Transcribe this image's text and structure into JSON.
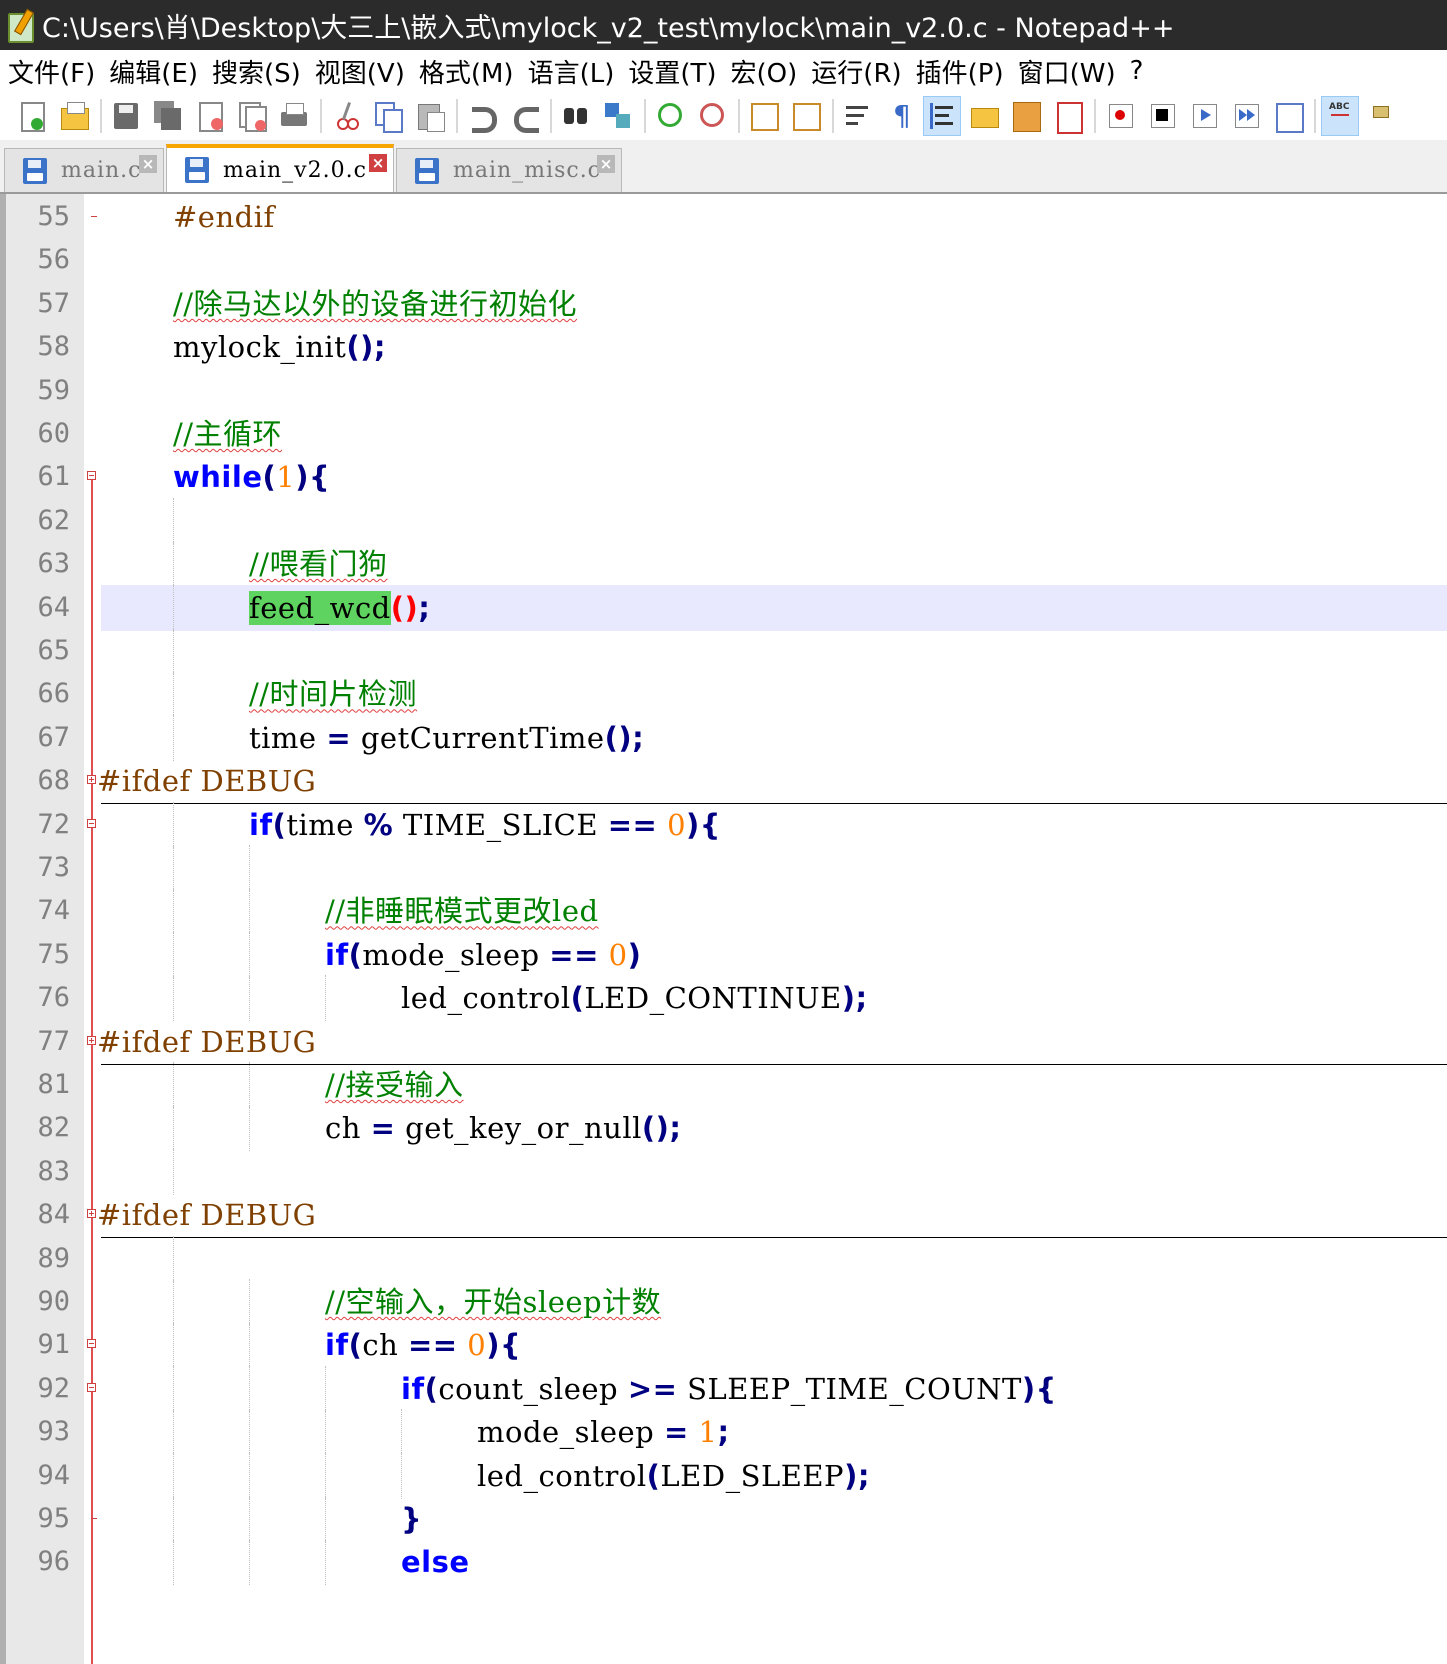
{
  "window": {
    "title": "C:\\Users\\肖\\Desktop\\大三上\\嵌入式\\mylock_v2_test\\mylock\\main_v2.0.c - Notepad++"
  },
  "menu": [
    "文件(F)",
    "编辑(E)",
    "搜索(S)",
    "视图(V)",
    "格式(M)",
    "语言(L)",
    "设置(T)",
    "宏(O)",
    "运行(R)",
    "插件(P)",
    "窗口(W)",
    "?"
  ],
  "toolbar": {
    "icons": [
      "new-file-icon",
      "open-file-icon",
      "save-icon",
      "save-all-icon",
      "close-icon",
      "close-all-icon",
      "print-icon",
      "cut-icon",
      "copy-icon",
      "paste-icon",
      "undo-icon",
      "redo-icon",
      "find-icon",
      "replace-icon",
      "zoom-in-icon",
      "zoom-out-icon",
      "sync-vertical-icon",
      "sync-horizontal-icon",
      "word-wrap-icon",
      "show-all-chars-icon",
      "indent-guide-icon",
      "user-define-lang-icon",
      "doc-map-icon",
      "function-list-icon",
      "record-macro-icon",
      "stop-record-icon",
      "play-macro-icon",
      "run-macro-multiple-icon",
      "save-macro-icon",
      "spell-check-icon",
      "spell-options-icon"
    ]
  },
  "tabs": [
    {
      "label": "main.c",
      "active": false
    },
    {
      "label": "main_v2.0.c",
      "active": true
    },
    {
      "label": "main_misc.c",
      "active": false
    }
  ],
  "editor": {
    "current_line": "64",
    "lines": [
      {
        "num": "55",
        "indent": "    ",
        "tokens": [
          {
            "t": "#endif",
            "c": "pp"
          }
        ]
      },
      {
        "num": "56",
        "indent": "",
        "tokens": []
      },
      {
        "num": "57",
        "indent": "    ",
        "tokens": [
          {
            "t": "//除马达以外的设备进行初始化",
            "c": "cm"
          }
        ]
      },
      {
        "num": "58",
        "indent": "    ",
        "tokens": [
          {
            "t": "mylock_init",
            "c": ""
          },
          {
            "t": "();",
            "c": "op"
          }
        ]
      },
      {
        "num": "59",
        "indent": "",
        "tokens": []
      },
      {
        "num": "60",
        "indent": "    ",
        "tokens": [
          {
            "t": "//主循环",
            "c": "cm"
          }
        ]
      },
      {
        "num": "61",
        "indent": "    ",
        "tokens": [
          {
            "t": "while",
            "c": "kw"
          },
          {
            "t": "(",
            "c": "op"
          },
          {
            "t": "1",
            "c": "num"
          },
          {
            "t": "){",
            "c": "op"
          }
        ]
      },
      {
        "num": "62",
        "indent": "",
        "tokens": []
      },
      {
        "num": "63",
        "indent": "        ",
        "tokens": [
          {
            "t": "//喂看门狗",
            "c": "cm"
          }
        ]
      },
      {
        "num": "64",
        "indent": "        ",
        "tokens": [
          {
            "t": "feed_wcd",
            "c": "hl"
          },
          {
            "t": "()",
            "c": "br-red"
          },
          {
            "t": ";",
            "c": "op"
          }
        ]
      },
      {
        "num": "65",
        "indent": "",
        "tokens": []
      },
      {
        "num": "66",
        "indent": "        ",
        "tokens": [
          {
            "t": "//时间片检测",
            "c": "cm"
          }
        ]
      },
      {
        "num": "67",
        "indent": "        ",
        "tokens": [
          {
            "t": "time ",
            "c": ""
          },
          {
            "t": "=",
            "c": "op"
          },
          {
            "t": " getCurrentTime",
            "c": ""
          },
          {
            "t": "();",
            "c": "op"
          }
        ]
      },
      {
        "num": "68",
        "indent": "",
        "tokens": [
          {
            "t": "#ifdef DEBUG",
            "c": "pp"
          }
        ]
      },
      {
        "num": "72",
        "indent": "        ",
        "tokens": [
          {
            "t": "if",
            "c": "kw"
          },
          {
            "t": "(",
            "c": "op"
          },
          {
            "t": "time ",
            "c": ""
          },
          {
            "t": "%",
            "c": "op"
          },
          {
            "t": " TIME_SLICE ",
            "c": ""
          },
          {
            "t": "==",
            "c": "op"
          },
          {
            "t": " ",
            "c": ""
          },
          {
            "t": "0",
            "c": "num"
          },
          {
            "t": "){",
            "c": "op"
          }
        ]
      },
      {
        "num": "73",
        "indent": "",
        "tokens": []
      },
      {
        "num": "74",
        "indent": "            ",
        "tokens": [
          {
            "t": "//非睡眠模式更改led",
            "c": "cm"
          }
        ]
      },
      {
        "num": "75",
        "indent": "            ",
        "tokens": [
          {
            "t": "if",
            "c": "kw"
          },
          {
            "t": "(",
            "c": "op"
          },
          {
            "t": "mode_sleep ",
            "c": ""
          },
          {
            "t": "==",
            "c": "op"
          },
          {
            "t": " ",
            "c": ""
          },
          {
            "t": "0",
            "c": "num"
          },
          {
            "t": ")",
            "c": "op"
          }
        ]
      },
      {
        "num": "76",
        "indent": "                ",
        "tokens": [
          {
            "t": "led_control",
            "c": ""
          },
          {
            "t": "(",
            "c": "op"
          },
          {
            "t": "LED_CONTINUE",
            "c": ""
          },
          {
            "t": ");",
            "c": "op"
          }
        ]
      },
      {
        "num": "77",
        "indent": "",
        "tokens": [
          {
            "t": "#ifdef DEBUG",
            "c": "pp"
          }
        ]
      },
      {
        "num": "81",
        "indent": "            ",
        "tokens": [
          {
            "t": "//接受输入",
            "c": "cm"
          }
        ]
      },
      {
        "num": "82",
        "indent": "            ",
        "tokens": [
          {
            "t": "ch ",
            "c": ""
          },
          {
            "t": "=",
            "c": "op"
          },
          {
            "t": " get_key_or_null",
            "c": ""
          },
          {
            "t": "();",
            "c": "op"
          }
        ]
      },
      {
        "num": "83",
        "indent": "",
        "tokens": []
      },
      {
        "num": "84",
        "indent": "",
        "tokens": [
          {
            "t": "#ifdef DEBUG",
            "c": "pp"
          }
        ]
      },
      {
        "num": "89",
        "indent": "",
        "tokens": []
      },
      {
        "num": "90",
        "indent": "            ",
        "tokens": [
          {
            "t": "//空输入，开始sleep计数",
            "c": "cm"
          }
        ]
      },
      {
        "num": "91",
        "indent": "            ",
        "tokens": [
          {
            "t": "if",
            "c": "kw"
          },
          {
            "t": "(",
            "c": "op"
          },
          {
            "t": "ch ",
            "c": ""
          },
          {
            "t": "==",
            "c": "op"
          },
          {
            "t": " ",
            "c": ""
          },
          {
            "t": "0",
            "c": "num"
          },
          {
            "t": "){",
            "c": "op"
          }
        ]
      },
      {
        "num": "92",
        "indent": "                ",
        "tokens": [
          {
            "t": "if",
            "c": "kw"
          },
          {
            "t": "(",
            "c": "op"
          },
          {
            "t": "count_sleep ",
            "c": ""
          },
          {
            "t": ">=",
            "c": "op"
          },
          {
            "t": " SLEEP_TIME_COUNT",
            "c": ""
          },
          {
            "t": "){",
            "c": "op"
          }
        ]
      },
      {
        "num": "93",
        "indent": "                    ",
        "tokens": [
          {
            "t": "mode_sleep ",
            "c": ""
          },
          {
            "t": "=",
            "c": "op"
          },
          {
            "t": " ",
            "c": ""
          },
          {
            "t": "1",
            "c": "num"
          },
          {
            "t": ";",
            "c": "op"
          }
        ]
      },
      {
        "num": "94",
        "indent": "                    ",
        "tokens": [
          {
            "t": "led_control",
            "c": ""
          },
          {
            "t": "(",
            "c": "op"
          },
          {
            "t": "LED_SLEEP",
            "c": ""
          },
          {
            "t": ");",
            "c": "op"
          }
        ]
      },
      {
        "num": "95",
        "indent": "                ",
        "tokens": [
          {
            "t": "}",
            "c": "op"
          }
        ]
      },
      {
        "num": "96",
        "indent": "                ",
        "tokens": [
          {
            "t": "else",
            "c": "kw"
          }
        ]
      }
    ]
  },
  "colors": {
    "keyword": "#0000ff",
    "number": "#ff8000",
    "operator": "#000080",
    "comment": "#008000",
    "preprocessor": "#804000",
    "line_number": "#808080",
    "current_line_bg": "#e8e8ff",
    "match_highlight": "#5fd35f",
    "active_tab_accent": "#f7a600"
  }
}
